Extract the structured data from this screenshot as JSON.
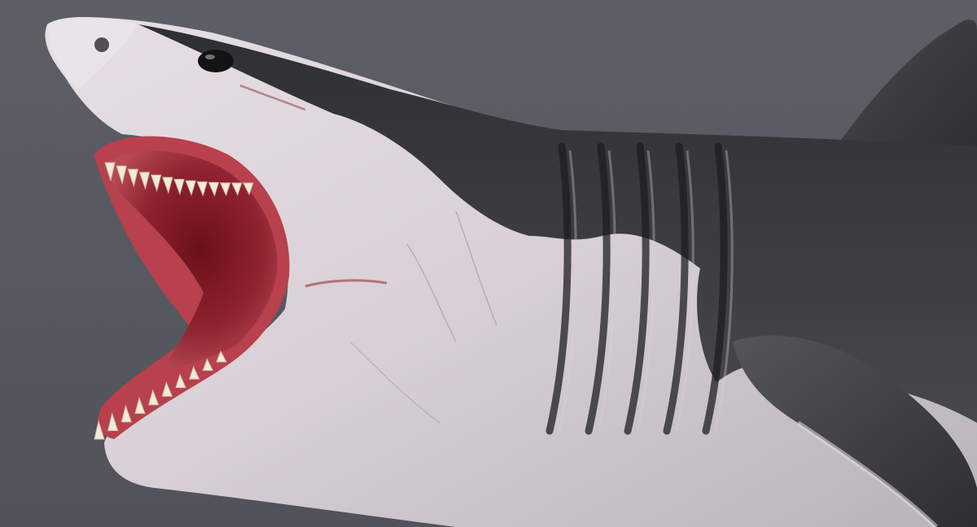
{
  "scene": {
    "subject": "great-white-shark",
    "colors": {
      "background": "#5a5a63",
      "dorsal_skin": "#3c3c3f",
      "ventral_skin": "#d9d2d6",
      "mouth_interior": "#8e1f29",
      "gums": "#b8323f",
      "teeth": "#f2ead8",
      "eye": "#141414"
    },
    "features": {
      "gill_slit_count": 5,
      "upper_teeth_count": 13,
      "lower_teeth_count": 10,
      "mouth_state": "open"
    }
  }
}
